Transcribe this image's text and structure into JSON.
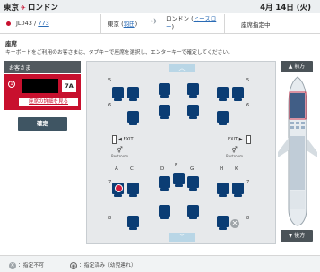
{
  "header": {
    "origin": "東京",
    "destination": "ロンドン",
    "date": "4月 14日 (火)"
  },
  "flight": {
    "airline_code": "JL043",
    "separator": "/",
    "code_link": "773",
    "departure_city": "東京",
    "departure_airport": "羽田",
    "arrival_city": "ロンドン",
    "arrival_airport": "ヒースロー",
    "status": "座席指定中"
  },
  "section": {
    "title": "座席",
    "instruction": "キーボードをご利用のお客さまは、タブキーで座席を選択し、エンターキーで確定してください。"
  },
  "passenger_panel": {
    "header": "お客さま",
    "passenger_number": "1",
    "seat": "7A",
    "detail_link": "座席の詳細を見る",
    "confirm_button": "確定"
  },
  "seatmap": {
    "row_labels": [
      "5",
      "6",
      "7",
      "8"
    ],
    "exit_label": "EXIT",
    "restroom_label": "Restroom",
    "columns": [
      "A",
      "C",
      "D",
      "E",
      "G",
      "H",
      "K"
    ]
  },
  "nav": {
    "front_button": "前方",
    "back_button": "後方"
  },
  "legend": {
    "unavailable": "：指定不可",
    "assigned_infant": "：指定済み（幼児連れ）"
  },
  "colors": {
    "brand_red": "#c8102e",
    "seat_blue": "#0b3d74",
    "dark_panel": "#52595e"
  }
}
